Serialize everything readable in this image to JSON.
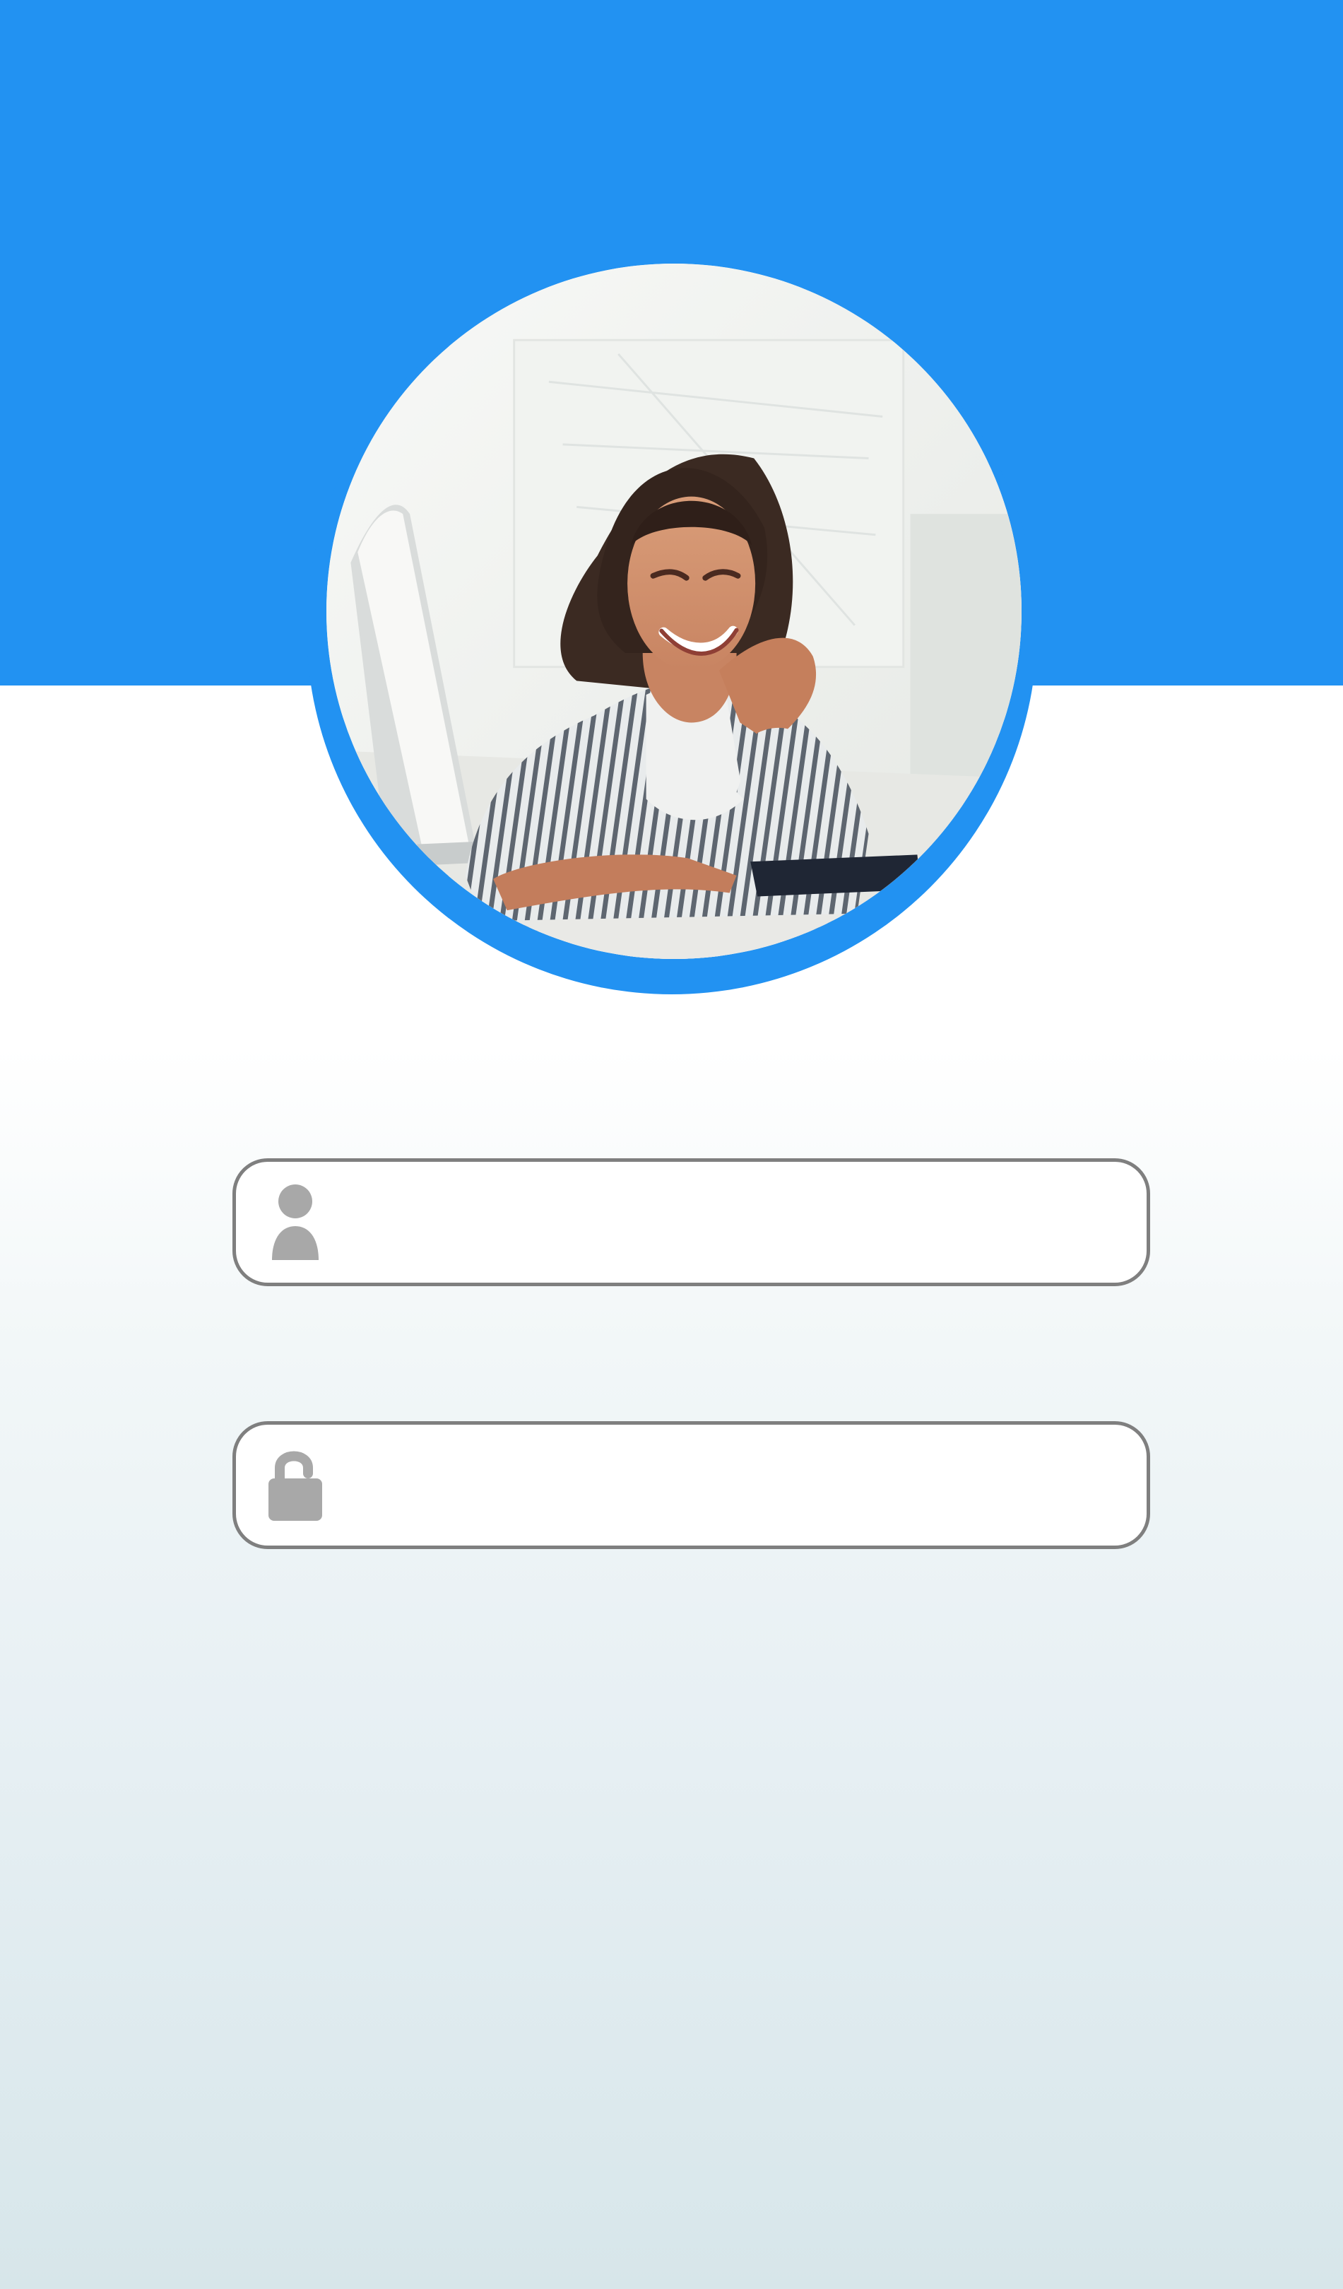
{
  "header": {
    "background_color": "#2292f2"
  },
  "profile": {
    "avatar_icon": "avatar-photo",
    "ring_color": "#2292f2"
  },
  "form": {
    "username": {
      "icon": "user-icon",
      "value": "",
      "placeholder": ""
    },
    "password": {
      "icon": "lock-icon",
      "value": "",
      "placeholder": ""
    }
  }
}
